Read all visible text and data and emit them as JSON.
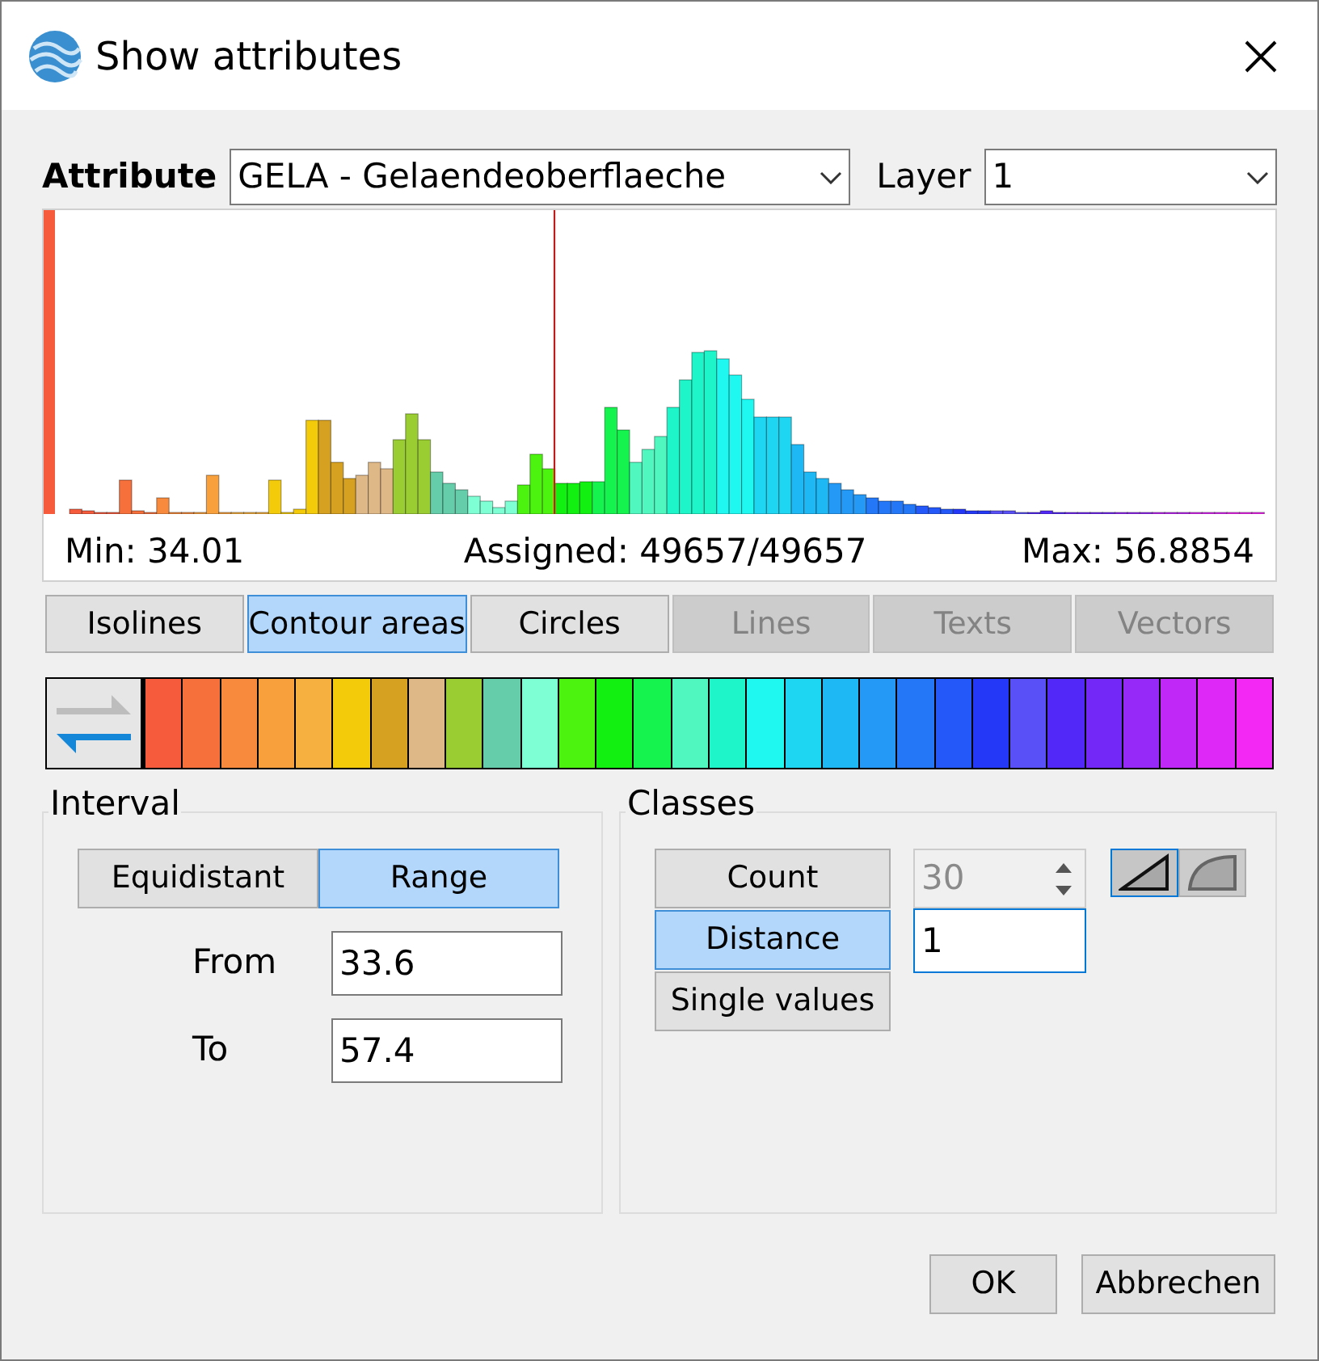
{
  "window": {
    "title": "Show attributes"
  },
  "attribute": {
    "label": "Attribute",
    "value": "GELA - Gelaendeoberflaeche"
  },
  "layer": {
    "label": "Layer",
    "value": "1"
  },
  "histogram": {
    "min": "Min: 34.01",
    "assigned": "Assigned: 49657/49657",
    "max": "Max: 56.8854"
  },
  "tabs": [
    {
      "label": "Isolines",
      "selected": false,
      "disabled": false
    },
    {
      "label": "Contour areas",
      "selected": true,
      "disabled": false
    },
    {
      "label": "Circles",
      "selected": false,
      "disabled": false
    },
    {
      "label": "Lines",
      "selected": false,
      "disabled": true
    },
    {
      "label": "Texts",
      "selected": false,
      "disabled": true
    },
    {
      "label": "Vectors",
      "selected": false,
      "disabled": true
    }
  ],
  "color_ramp": [
    {
      "color": "#f65c3c"
    },
    {
      "color": "#f6703c"
    },
    {
      "color": "#f78a3c"
    },
    {
      "color": "#f7a03c"
    },
    {
      "color": "#f5b040"
    },
    {
      "color": "#f4cb0a"
    },
    {
      "color": "#d6a020"
    },
    {
      "color": "#deb887"
    },
    {
      "color": "#9acd32"
    },
    {
      "color": "#66cdaa"
    },
    {
      "color": "#7fffd4"
    },
    {
      "color": "#4cf30f"
    },
    {
      "color": "#12f012"
    },
    {
      "color": "#15f44e"
    },
    {
      "color": "#50f8c0"
    },
    {
      "color": "#1ef5c8"
    },
    {
      "color": "#1ef8f0"
    },
    {
      "color": "#1ed6f2"
    },
    {
      "color": "#1eb8f5"
    },
    {
      "color": "#2499f5"
    },
    {
      "color": "#2478f8"
    },
    {
      "color": "#2458f8"
    },
    {
      "color": "#2438f8"
    },
    {
      "color": "#5a50f8"
    },
    {
      "color": "#5228f8"
    },
    {
      "color": "#7428f8"
    },
    {
      "color": "#9628f8"
    },
    {
      "color": "#c028f8"
    },
    {
      "color": "#de28f8"
    },
    {
      "color": "#f428f4"
    }
  ],
  "interval": {
    "title": "Interval",
    "modes": [
      {
        "label": "Equidistant",
        "selected": false
      },
      {
        "label": "Range",
        "selected": true
      }
    ],
    "from": {
      "label": "From",
      "value": "33.6"
    },
    "to": {
      "label": "To",
      "value": "57.4"
    }
  },
  "classes": {
    "title": "Classes",
    "modes": [
      {
        "label": "Count",
        "selected": false
      },
      {
        "label": "Distance",
        "selected": true
      },
      {
        "label": "Single values",
        "selected": false
      }
    ],
    "count": {
      "value": "30",
      "disabled": true
    },
    "distance": {
      "value": "1"
    },
    "scales": [
      {
        "kind": "linear",
        "selected": true
      },
      {
        "kind": "curve",
        "selected": false
      }
    ]
  },
  "buttons": [
    "OK",
    "Abbrechen"
  ]
}
